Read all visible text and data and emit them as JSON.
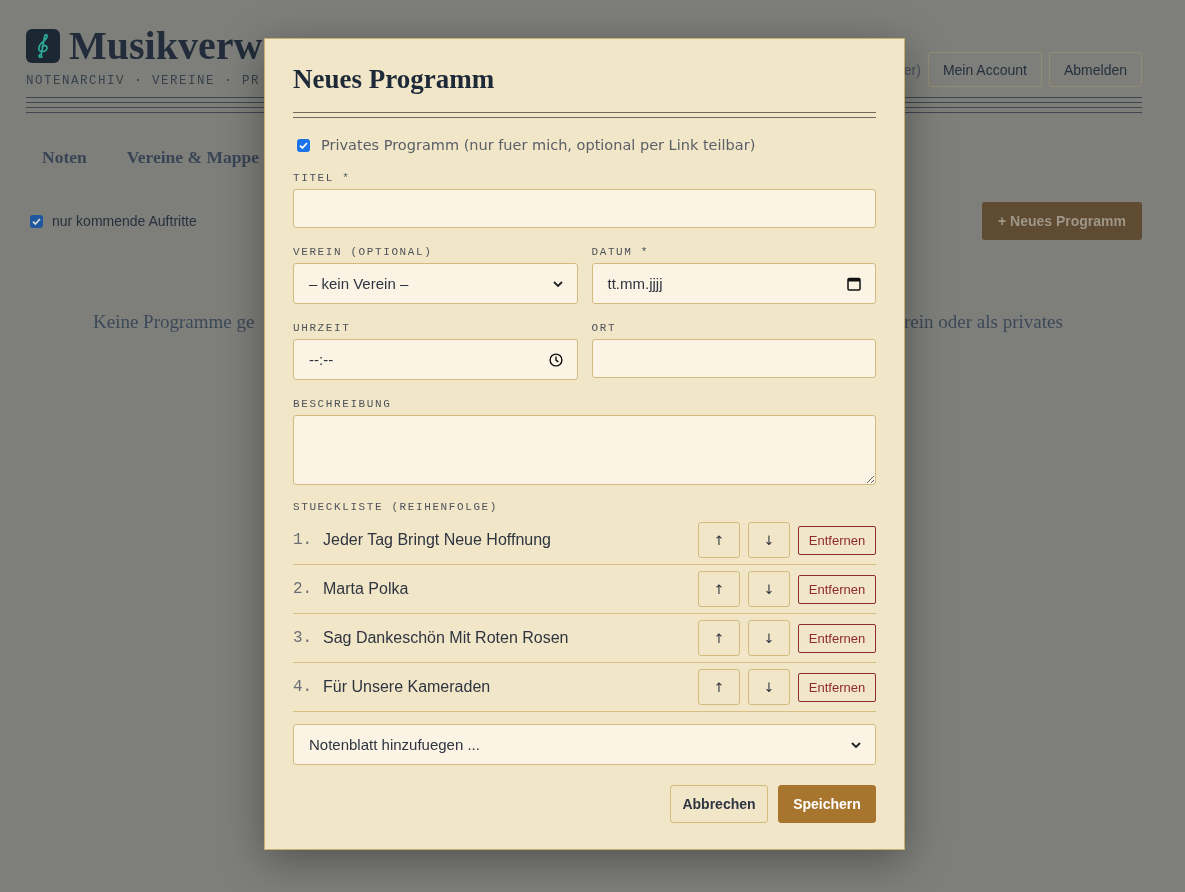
{
  "header": {
    "title": "Musikverw",
    "subtitle": "NOTENARCHIV · VEREINE · PR",
    "user_text": "er)",
    "buttons": [
      "Mein Account",
      "Abmelden"
    ]
  },
  "nav": [
    {
      "label": "Noten",
      "selected": false
    },
    {
      "label": "Vereine & Mappe",
      "selected": false
    }
  ],
  "filter": {
    "label": "nur kommende Auftritte",
    "checked": true
  },
  "new_button": "+ Neues Programm",
  "empty_message": [
    "Keine Programme ge",
    "rein oder als privates"
  ],
  "dialog": {
    "title": "Neues Programm",
    "private": {
      "label": "Privates Programm (nur fuer mich, optional per Link teilbar)",
      "checked": true
    },
    "field_rows": [
      [
        {
          "kind": "text",
          "label": "TITEL *"
        }
      ],
      [
        {
          "kind": "select",
          "label": "VEREIN (OPTIONAL)",
          "value": "– kein Verein –"
        },
        {
          "kind": "date",
          "label": "DATUM *",
          "placeholder": "tt.mm.jjjj"
        }
      ],
      [
        {
          "kind": "time",
          "label": "UHRZEIT",
          "placeholder": "--:--"
        },
        {
          "kind": "text",
          "label": "ORT"
        }
      ],
      [
        {
          "kind": "textarea",
          "label": "BESCHREIBUNG"
        }
      ]
    ],
    "pieces_label": "STUECKLISTE (REIHENFOLGE)",
    "pieces": [
      {
        "number": "1.",
        "title": "Jeder Tag Bringt Neue Hoffnung",
        "up": "↑",
        "down": "↓",
        "remove": "Entfernen"
      },
      {
        "number": "2.",
        "title": "Marta Polka",
        "up": "↑",
        "down": "↓",
        "remove": "Entfernen"
      },
      {
        "number": "3.",
        "title": "Sag Dankeschön Mit Roten Rosen",
        "up": "↑",
        "down": "↓",
        "remove": "Entfernen"
      },
      {
        "number": "4.",
        "title": "Für Unsere Kameraden",
        "up": "↑",
        "down": "↓",
        "remove": "Entfernen"
      }
    ],
    "add_select": {
      "value": "Notenblatt hinzufuegen ..."
    },
    "buttons": [
      {
        "kind": "secondary",
        "label": "Abbrechen"
      },
      {
        "kind": "primary",
        "label": "Speichern"
      }
    ]
  }
}
